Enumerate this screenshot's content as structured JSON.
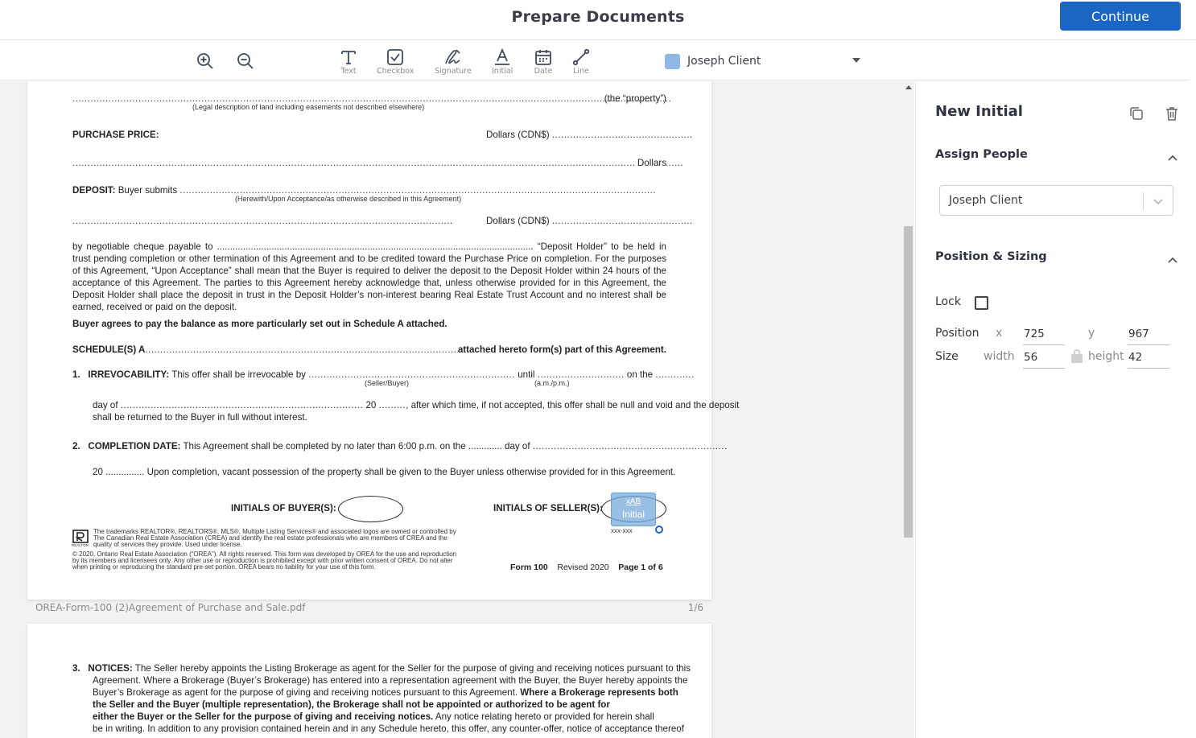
{
  "header": {
    "title": "Prepare Documents",
    "continue_label": "Continue"
  },
  "toolbar": {
    "zoom_in_icon": "zoom-in-icon",
    "zoom_out_icon": "zoom-out-icon",
    "tools": [
      {
        "label": "Text",
        "icon": "text-icon"
      },
      {
        "label": "Checkbox",
        "icon": "checkbox-icon"
      },
      {
        "label": "Signature",
        "icon": "signature-icon"
      },
      {
        "label": "Initial",
        "icon": "initial-icon"
      },
      {
        "label": "Date",
        "icon": "calendar-icon"
      },
      {
        "label": "Line",
        "icon": "line-icon"
      }
    ],
    "signer": {
      "name": "Joseph Client",
      "color": "#8fb8e6"
    }
  },
  "document": {
    "lines": {
      "property": "(the “property”)",
      "legal_desc": "(Legal description of land including easements not described elsewhere)",
      "purchase_price_label": "PURCHASE PRICE:",
      "dollars_cdn": "Dollars (CDN$)",
      "dollars": "Dollars",
      "deposit_label": "DEPOSIT:",
      "buyer_submits": "Buyer submits",
      "herewith": "(Herewith/Upon Acceptance/as otherwise described in this Agreement)",
      "dollars_cdn_2": "Dollars (CDN$)",
      "deposit_para": "by negotiable cheque payable to .......................................................................................................................... “Deposit Holder” to be held in trust pending completion or other termination of this Agreement and to be credited toward the Purchase Price on completion. For the purposes of this Agreement, “Upon Acceptance” shall mean that the Buyer is required to deliver the deposit to the Deposit Holder within 24 hours of the acceptance of this Agreement. The parties to this Agreement hereby acknowledge that, unless otherwise provided for in this Agreement, the Deposit Holder shall place the deposit in trust in the Deposit Holder’s non-interest bearing Real Estate Trust Account and no interest shall be earned, received or paid on the deposit.",
      "balance": "Buyer agrees to pay the balance as more particularly set out in Schedule A attached.",
      "schedule_a": "SCHEDULE(S) A",
      "attached_hereto": "attached hereto form(s) part of this Agreement.",
      "irrevocability_num": "1.",
      "irrevocability_label": "IRREVOCABILITY:",
      "irrevocability_text": "This offer shall be irrevocable by",
      "until": "until",
      "on_the": "on the",
      "seller_buyer": "(Seller/Buyer)",
      "am_pm": "(a.m./p.m.)",
      "day_of": "day of",
      "twenty": "20",
      "after_which": ", after which time, if not accepted, this offer shall be null and void and the deposit",
      "returned": "shall be returned to the Buyer in full without interest.",
      "completion_num": "2.",
      "completion_label": "COMPLETION DATE:",
      "completion_text": "This Agreement shall be completed by no later than 6:00 p.m. on the ............. day of",
      "completion_2": "20 ............... Upon completion, vacant possession of the property shall be given to the Buyer unless otherwise provided for in this Agreement.",
      "initials_buyer": "INITIALS OF BUYER(S):",
      "initials_seller": "INITIALS OF SELLER(S):",
      "xxx": "xxx-xxx",
      "realtor": "REALTOR",
      "trademark_1": "The trademarks REALTOR®, REALTORS®, MLS®, Multiple Listing Services® and associated logos are owned or controlled by",
      "trademark_2": "The Canadian Real Estate Association (CREA) and identify the real estate professionals who are members of CREA and the",
      "trademark_3": "quality of services they provide. Used under license.",
      "copyright_1": "© 2020, Ontario Real Estate Association (“OREA”). All rights reserved. This form was developed by OREA for the use and reproduction",
      "copyright_2": "by its members and licensees only. Any other use or reproduction is prohibited except with prior written consent of OREA. Do not alter",
      "copyright_3": "when printing or reproducing the standard pre-set portion. OREA bears no liability for your use of this form.",
      "form_100": "Form 100",
      "revised": "Revised 2020",
      "page_of": "Page 1 of 6"
    },
    "file_name": "OREA-Form-100 (2)Agreement of Purchase and Sale.pdf",
    "page_count": "1/6",
    "page2": {
      "notices_num": "3.",
      "notices_label": "NOTICES:",
      "notices_l1": "The Seller hereby appoints the Listing Brokerage as agent for the Seller for the purpose of giving and receiving notices pursuant to this",
      "notices_l2": "Agreement. Where a Brokerage (Buyer’s Brokerage) has entered into a representation agreement with the Buyer, the Buyer hereby appoints the",
      "notices_l3a": "Buyer’s Brokerage as agent for the purpose of giving and receiving notices pursuant to this Agreement.",
      "notices_l3b": "Where a Brokerage represents both",
      "notices_l4": "the Seller and the Buyer (multiple representation), the Brokerage shall not be appointed or authorized to be agent for",
      "notices_l5a": "either the Buyer or the Seller for the purpose of giving and receiving notices.",
      "notices_l5b": "Any notice relating hereto or provided for herein shall",
      "notices_l6": "be in writing. In addition to any provision contained herein and in any Schedule hereto, this offer, any counter-offer, notice of acceptance thereof"
    },
    "initial_field": {
      "mini": "xAB",
      "label": "Initial"
    }
  },
  "panel": {
    "title": "New Initial",
    "duplicate_icon": "copy-icon",
    "delete_icon": "trash-icon",
    "assign_title": "Assign People",
    "assign_value": "Joseph Client",
    "position_title": "Position & Sizing",
    "lock_label": "Lock",
    "position_label": "Position",
    "x_label": "x",
    "y_label": "y",
    "x_value": "725",
    "y_value": "967",
    "size_label": "Size",
    "width_label": "width",
    "height_label": "height",
    "width_value": "56",
    "height_value": "42"
  },
  "colors": {
    "accent": "#1a66c2",
    "signer": "#8fb8e6"
  }
}
